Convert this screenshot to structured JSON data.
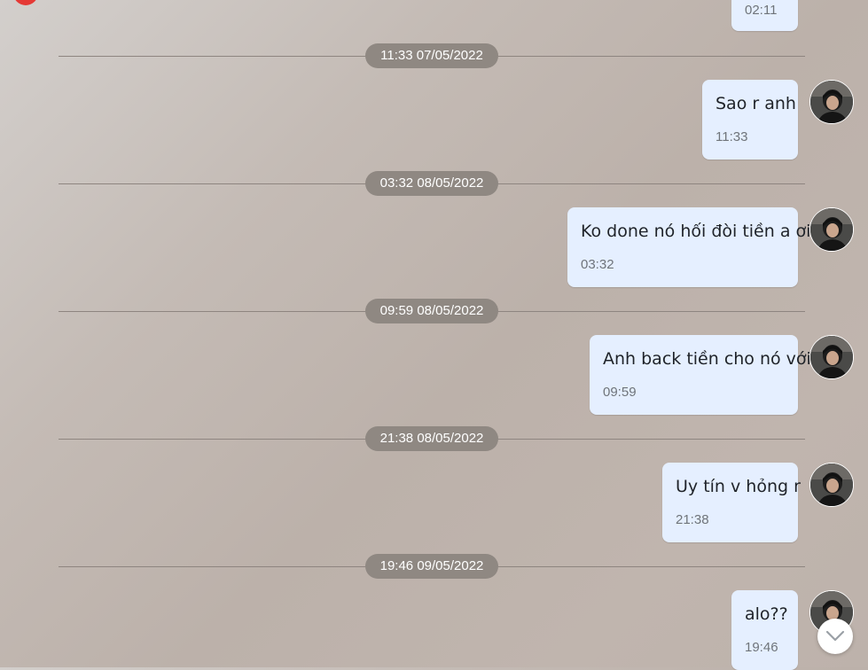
{
  "messages_top": {
    "prev_time": "02:11"
  },
  "groups": [
    {
      "date": "11:33 07/05/2022",
      "text": "Sao r anh",
      "time": "11:33"
    },
    {
      "date": "03:32 08/05/2022",
      "text": "Ko done nó hối đòi tiền a ơi",
      "time": "03:32"
    },
    {
      "date": "09:59 08/05/2022",
      "text": "Anh back tiền cho nó với",
      "time": "09:59"
    },
    {
      "date": "21:38 08/05/2022",
      "text": "Uy tín v hỏng r",
      "time": "21:38"
    },
    {
      "date": "19:46 09/05/2022",
      "text": "alo??",
      "time": "19:46"
    }
  ],
  "colors": {
    "bubble": "#e5efff",
    "pill": "#8f8882",
    "accent": "#e53935"
  },
  "icons": {
    "scroll": "chevron-down-icon",
    "avatar": "user-avatar"
  }
}
